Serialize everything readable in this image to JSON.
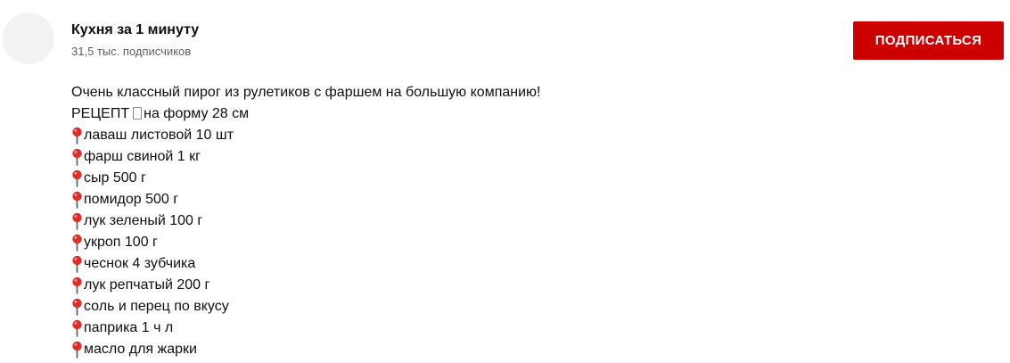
{
  "channel": {
    "name": "Кухня за 1 минуту",
    "subscribers": "31,5 тыс. подписчиков"
  },
  "subscribe_button": {
    "label": "ПОДПИСАТЬСЯ"
  },
  "description": {
    "intro": "Очень классный пирог из рулетиков с фаршем на большую компанию!",
    "recipe_label": "РЕЦЕПТ",
    "recipe_form": "на форму 28 см",
    "ingredients": [
      "лаваш листовой 10 шт",
      "фарш свиной 1 кг",
      "сыр 500 г",
      "помидор 500 г",
      "лук зеленый 100 г",
      "укроп 100 г",
      "чеснок 4 зубчика",
      "лук репчатый 200 г",
      "соль и перец по вкусу",
      "паприка 1 ч л",
      "масло для жарки"
    ]
  },
  "colors": {
    "subscribe_bg": "#cc0000",
    "pin_red": "#d9302c"
  },
  "icons": {
    "ingredient_bullet": "round-pushpin-icon",
    "recipe_marker": "unknown-glyph-box-icon"
  }
}
